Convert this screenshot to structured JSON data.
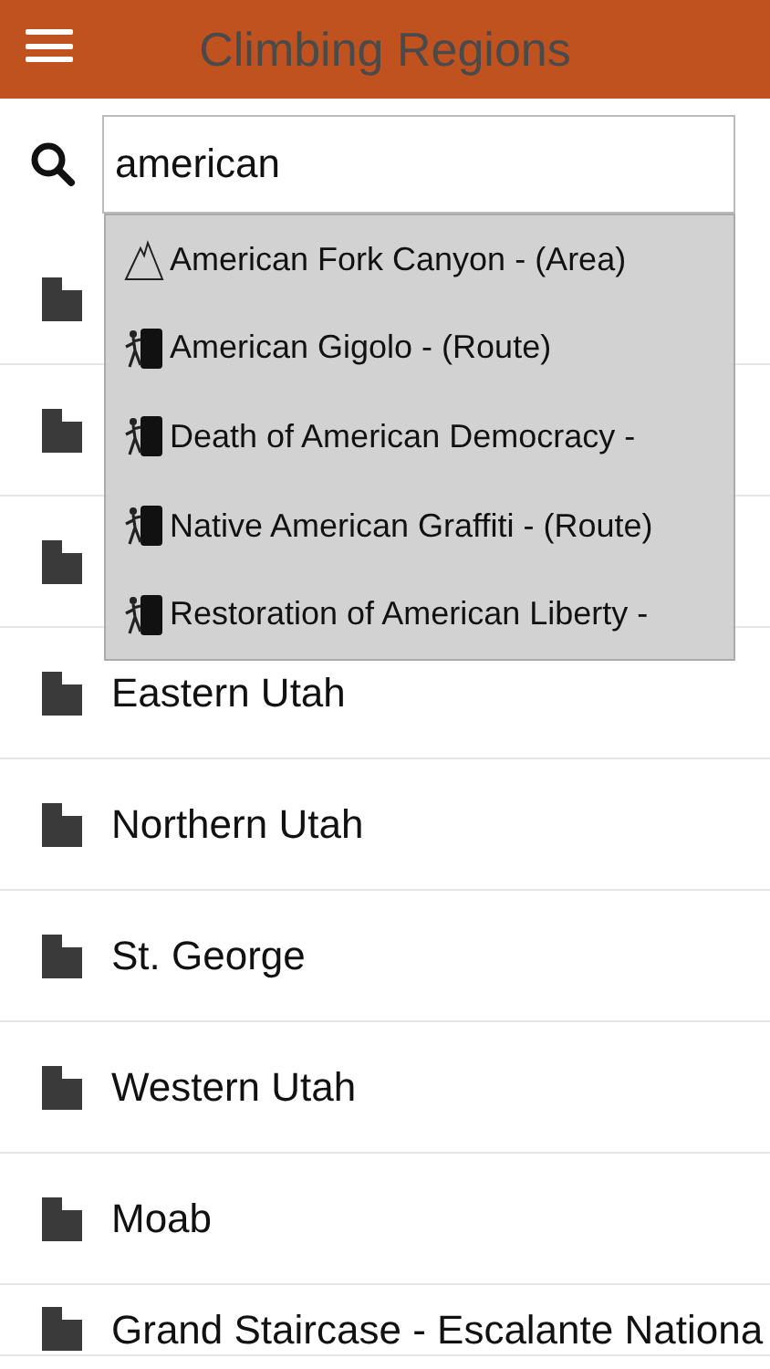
{
  "header": {
    "title": "Climbing Regions"
  },
  "search": {
    "value": "american"
  },
  "suggestions": [
    {
      "kind": "area",
      "text": "American Fork Canyon - (Area)"
    },
    {
      "kind": "route",
      "text": "American Gigolo - (Route)"
    },
    {
      "kind": "route",
      "text": "Death of American Democracy -"
    },
    {
      "kind": "route",
      "text": "Native American Graffiti - (Route)"
    },
    {
      "kind": "route",
      "text": "Restoration of American Liberty -"
    }
  ],
  "regions": [
    {
      "kind": "folder"
    },
    {
      "kind": "folder"
    },
    {
      "kind": "folder"
    },
    {
      "kind": "folder",
      "name": "Eastern Utah"
    },
    {
      "kind": "folder",
      "name": "Northern Utah"
    },
    {
      "kind": "folder",
      "name": "St. George"
    },
    {
      "kind": "folder",
      "name": "Western Utah"
    },
    {
      "kind": "folder",
      "name": "Moab"
    },
    {
      "kind": "folder",
      "name": "Grand Staircase - Escalante Nationa"
    }
  ]
}
